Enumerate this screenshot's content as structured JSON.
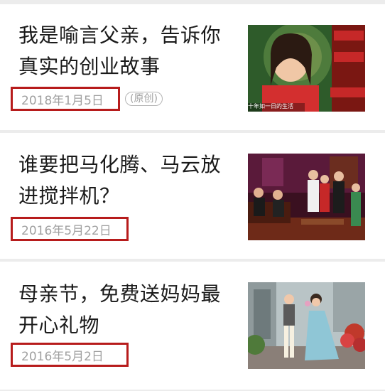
{
  "articles": [
    {
      "title": "我是喻言父亲，告诉你真实的创业故事",
      "date": "2018年1月5日",
      "badge": "(原创)",
      "image": "girl-on-tv-show-thumbnail",
      "image_caption": "十年如一日的生活"
    },
    {
      "title": "谁要把马化腾、马云放进搅拌机？",
      "date": "2016年5月22日",
      "image": "tv-studio-panel-thumbnail"
    },
    {
      "title": "母亲节，免费送妈妈最开心礼物",
      "date": "2016年5月2日",
      "image": "mother-and-child-thumbnail"
    }
  ],
  "colors": {
    "highlight_border": "#b71c1c",
    "date_text": "#a0a0a0",
    "title_text": "#1a1a1a"
  }
}
